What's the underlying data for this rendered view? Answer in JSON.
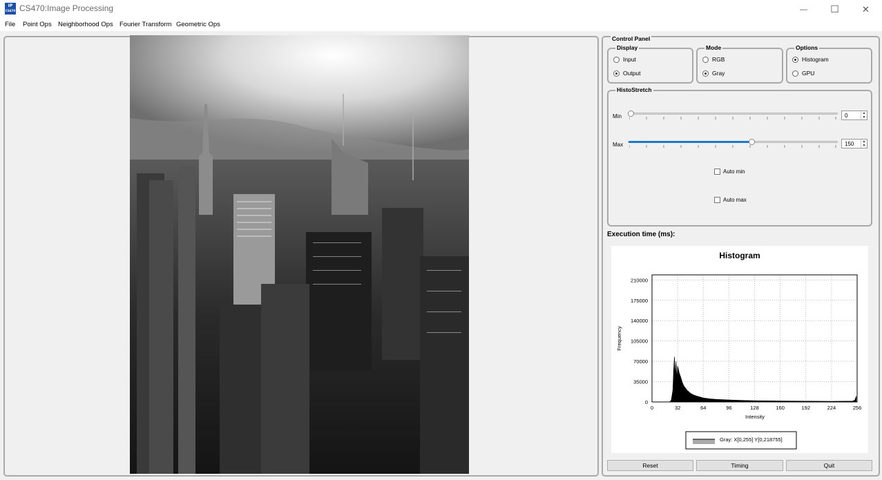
{
  "window": {
    "app_icon_top": "IP",
    "app_icon_bottom": "CS470",
    "title": "CS470:Image Processing",
    "minimize_glyph": "—",
    "maximize_glyph": "☐",
    "close_glyph": "✕"
  },
  "menu": [
    "File",
    "Point Ops",
    "Neighborhood Ops",
    "Fourier Transform",
    "Geometric Ops"
  ],
  "control_panel": {
    "title": "Control Panel",
    "display": {
      "title": "Display",
      "options": [
        "Input",
        "Output"
      ],
      "selected": "Output"
    },
    "mode": {
      "title": "Mode",
      "options": [
        "RGB",
        "Gray"
      ],
      "selected": "Gray"
    },
    "options": {
      "title": "Options",
      "options": [
        "Histogram",
        "GPU"
      ],
      "selected": "Histogram"
    },
    "histostretch": {
      "title": "HistoStretch",
      "min_label": "Min",
      "max_label": "Max",
      "min_value": "0",
      "max_value": "150",
      "slider_max": 255,
      "auto_min_label": "Auto min",
      "auto_max_label": "Auto max"
    }
  },
  "execution_time_label": "Execution time (ms):",
  "histogram": {
    "title": "Histogram",
    "xlabel": "Intensity",
    "ylabel": "Frequency",
    "legend": "Gray: X[0,255] Y[0,218755]"
  },
  "buttons": {
    "reset": "Reset",
    "timing": "Timing",
    "quit": "Quit"
  },
  "colors": {
    "slider_fill": "#1f78c6",
    "frame": "#a9a9a9"
  },
  "chart_data": {
    "type": "area",
    "title": "Histogram",
    "xlabel": "Intensity",
    "ylabel": "Frequency",
    "xlim": [
      0,
      256
    ],
    "ylim": [
      0,
      218755
    ],
    "x_ticks": [
      0,
      32,
      64,
      96,
      128,
      160,
      192,
      224,
      256
    ],
    "y_ticks": [
      0,
      35000,
      70000,
      105000,
      140000,
      175000,
      210000
    ],
    "grid": true,
    "legend": "bottom",
    "series": [
      {
        "name": "Gray: X[0,255] Y[0,218755]",
        "x": [
          0,
          22,
          24,
          26,
          27,
          28,
          29,
          30,
          31,
          32,
          34,
          36,
          38,
          40,
          44,
          48,
          52,
          56,
          60,
          64,
          72,
          80,
          96,
          112,
          128,
          160,
          192,
          224,
          250,
          253,
          255
        ],
        "y": [
          0,
          0,
          3000,
          20000,
          55000,
          78000,
          45000,
          70000,
          40000,
          62000,
          50000,
          42000,
          33000,
          27000,
          20000,
          15000,
          12000,
          10000,
          8500,
          7000,
          5500,
          4500,
          3500,
          2800,
          2200,
          1700,
          1400,
          1200,
          1500,
          3000,
          10000
        ]
      }
    ]
  }
}
